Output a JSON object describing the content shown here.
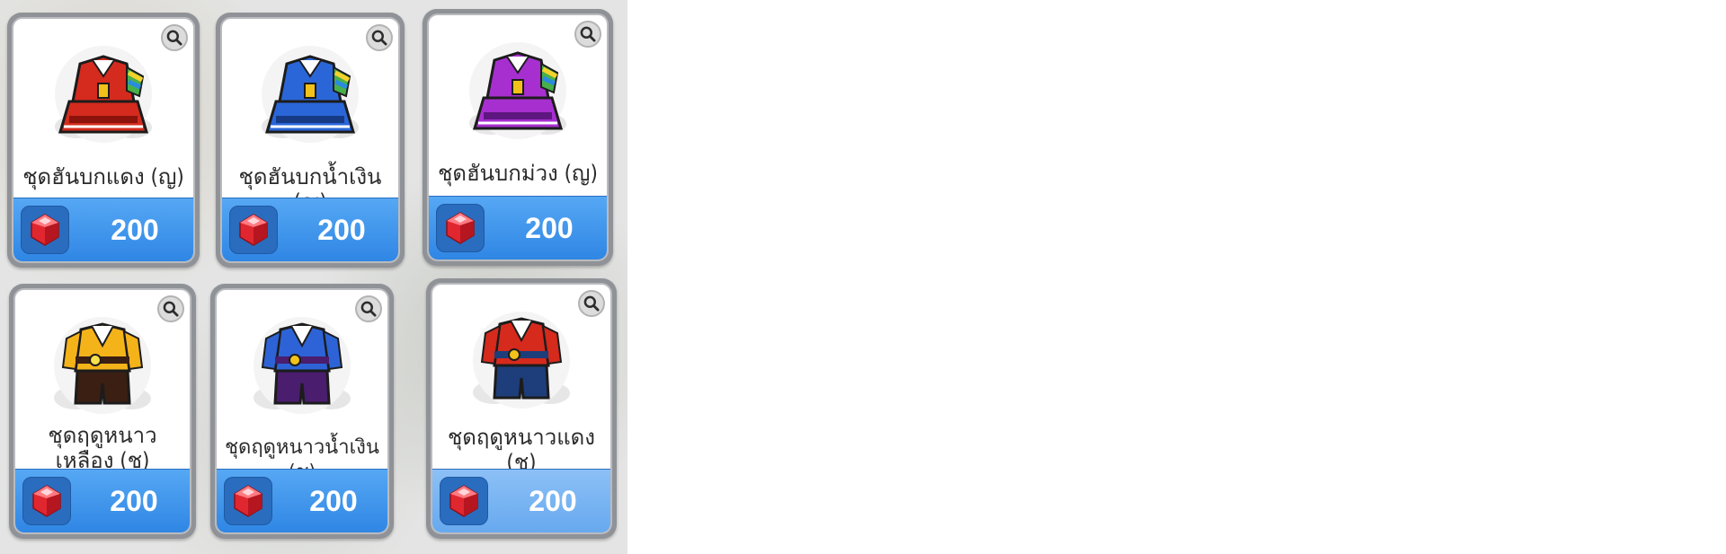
{
  "shop": {
    "items": [
      {
        "name": "ชุดฮันบกแดง (ญ)",
        "price": "200",
        "currency": "ruby-gem-icon",
        "colors": {
          "main": "#d42b1e",
          "dark": "#8b130c",
          "accent": "#f2c21a"
        }
      },
      {
        "name": "ชุดฮันบกน้ำเงิน (ญ)",
        "price": "200",
        "currency": "ruby-gem-icon",
        "colors": {
          "main": "#2a66d8",
          "dark": "#173a85",
          "accent": "#f2c21a"
        }
      },
      {
        "name": "ชุดฮันบกม่วง (ญ)",
        "price": "200",
        "currency": "ruby-gem-icon",
        "colors": {
          "main": "#a72fd0",
          "dark": "#5e1780",
          "accent": "#f2c21a"
        }
      },
      {
        "name": "ชุดฤดูหนาวเหลือง (ช)",
        "price": "200",
        "currency": "ruby-gem-icon",
        "colors": {
          "main": "#f5b31a",
          "dark": "#3a1f12",
          "accent": "#f7e04a"
        }
      },
      {
        "name": "ชุดฤดูหนาวน้ำเงิน (ช)",
        "price": "200",
        "currency": "ruby-gem-icon",
        "colors": {
          "main": "#2d63d6",
          "dark": "#4a1d6e",
          "accent": "#f2c21a"
        }
      },
      {
        "name": "ชุดฤดูหนาวแดง (ช)",
        "price": "200",
        "currency": "ruby-gem-icon",
        "colors": {
          "main": "#d52a1c",
          "dark": "#1d3e7a",
          "accent": "#f2c21a"
        }
      }
    ]
  },
  "colors": {
    "price_bar": "#3b8eea",
    "card_frame": "#8f9296",
    "price_text": "#ffffff",
    "gem": "#e02730"
  }
}
